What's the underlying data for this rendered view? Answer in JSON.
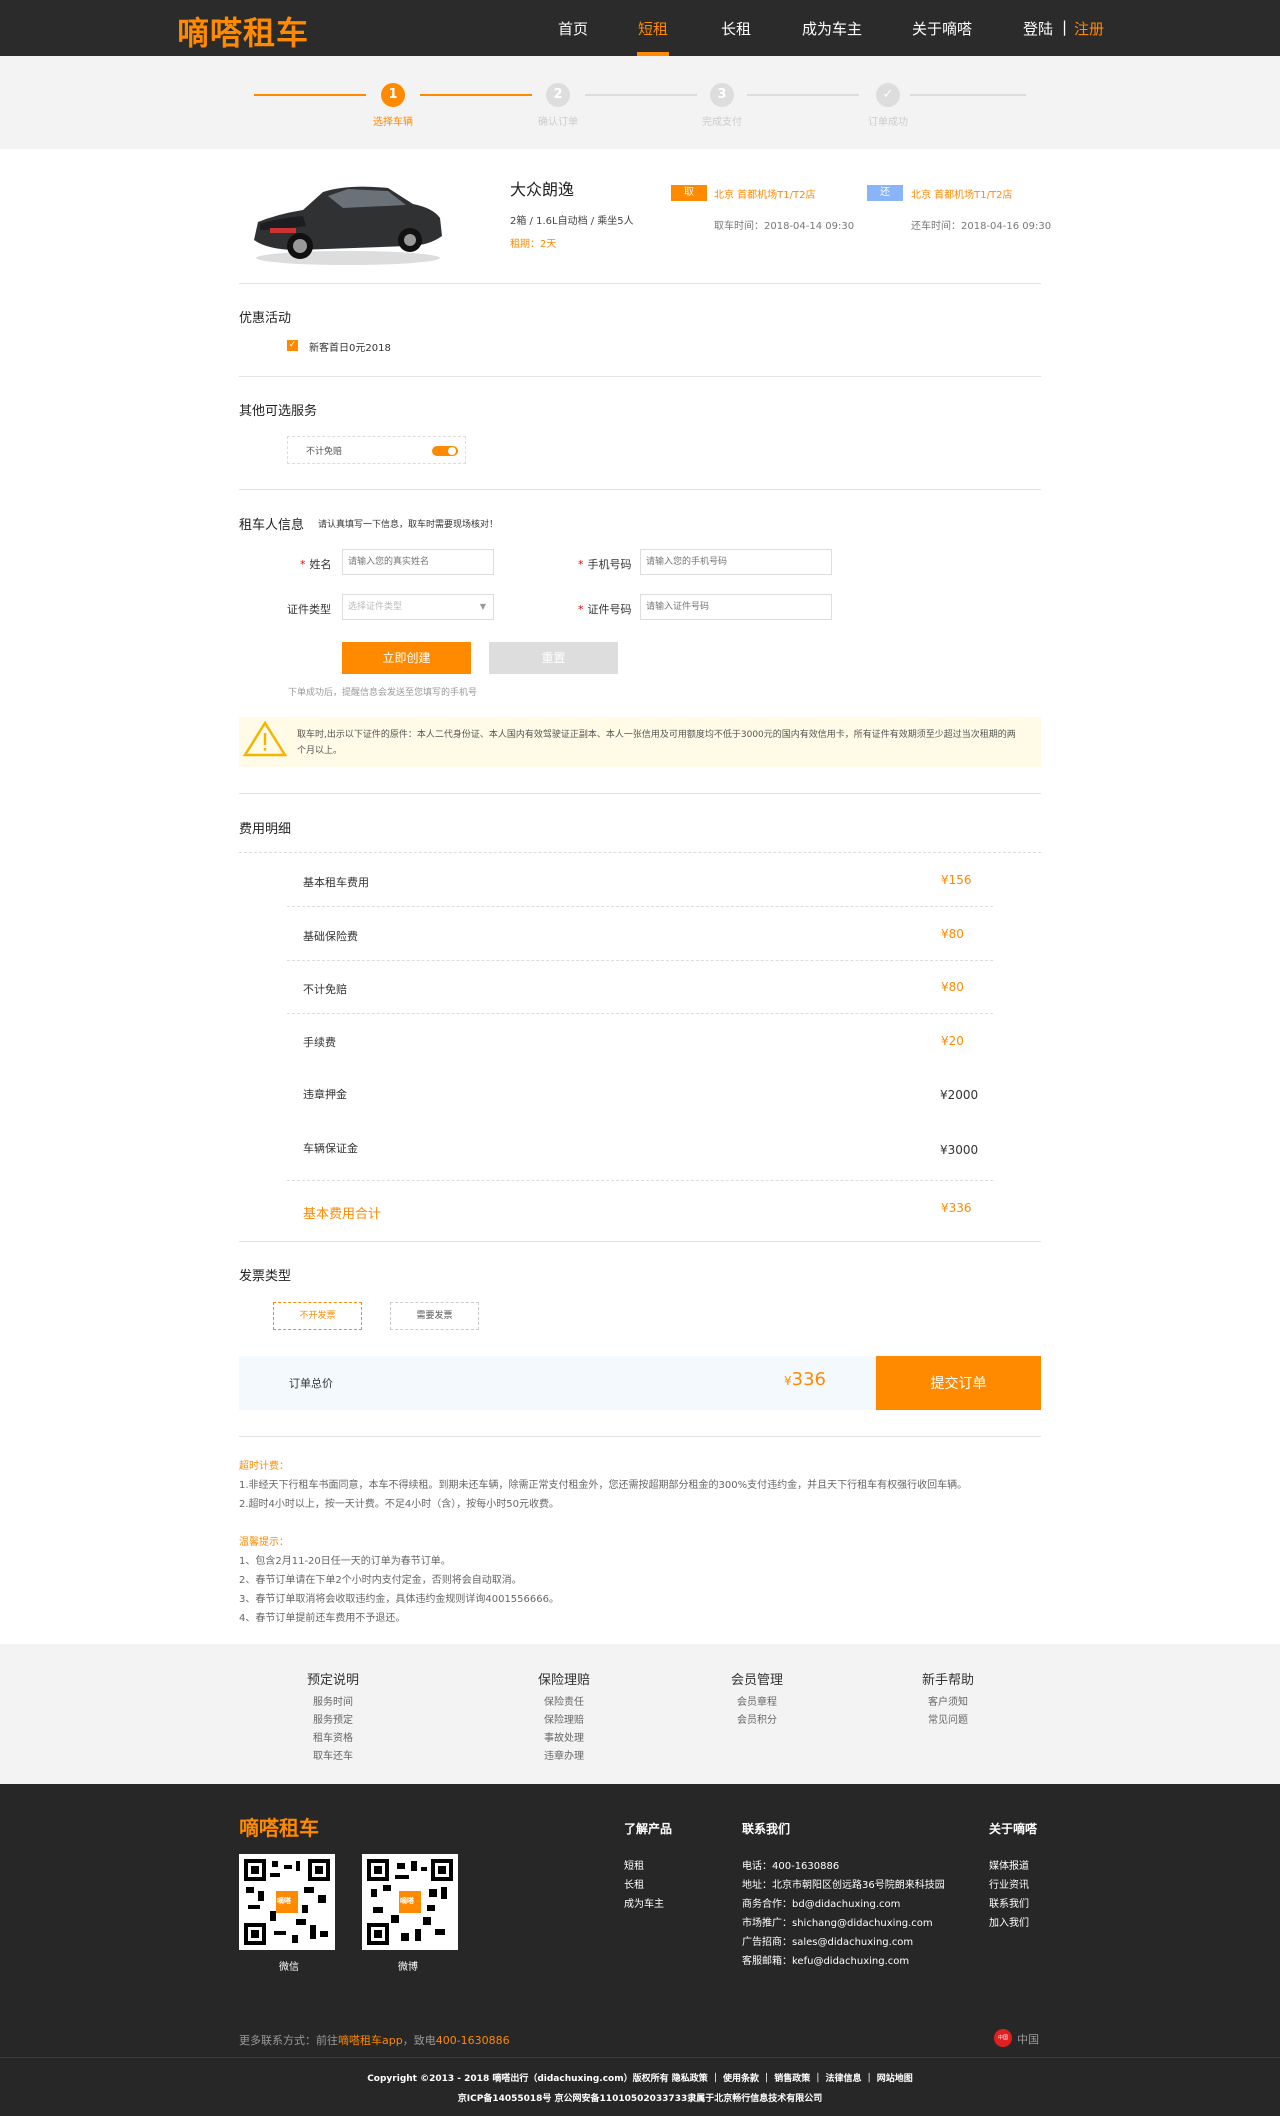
{
  "header": {
    "logo": "嘀嗒租车",
    "nav": [
      "首页",
      "短租",
      "长租",
      "成为车主",
      "关于嘀嗒"
    ],
    "login": "登陆",
    "sep": "|",
    "register": "注册"
  },
  "steps": [
    {
      "num": "1",
      "label": "选择车辆"
    },
    {
      "num": "2",
      "label": "确认订单"
    },
    {
      "num": "3",
      "label": "完成支付"
    },
    {
      "num": "✓",
      "label": "订单成功"
    }
  ],
  "car": {
    "name": "大众朗逸",
    "spec": "2箱 / 1.6L自动档 / 乘坐5人",
    "days": "租期：2天",
    "pickup_badge": "取",
    "return_badge": "还",
    "pickup_loc": "北京 首都机场T1/T2店",
    "return_loc": "北京 首都机场T1/T2店",
    "pickup_time": "取车时间：2018-04-14 09:30",
    "return_time": "还车时间：2018-04-16 09:30"
  },
  "promo": {
    "title": "优惠活动",
    "item": "新客首日0元2018"
  },
  "services": {
    "title": "其他可选服务",
    "item": "不计免赔"
  },
  "renter": {
    "title": "租车人信息",
    "hint": "请认真填写一下信息，取车时需要现场核对！",
    "name_label": "姓名",
    "name_ph": "请输入您的真实姓名",
    "phone_label": "手机号码",
    "phone_ph": "请输入您的手机号码",
    "idtype_label": "证件类型",
    "idtype_ph": "选择证件类型",
    "idnum_label": "证件号码",
    "idnum_ph": "请输入证件号码",
    "req": "*",
    "create_btn": "立即创建",
    "reset_btn": "重置",
    "submit_hint": "下单成功后，提醒信息会发送至您填写的手机号",
    "warning": "取车时,出示以下证件的原件：本人二代身份证、本人国内有效驾驶证正副本、本人一张信用及可用额度均不低于3000元的国内有效信用卡，所有证件有效期须至少超过当次租期的两个月以上。"
  },
  "fees": {
    "title": "费用明细",
    "items": [
      {
        "name": "基本租车费用",
        "value": "¥156"
      },
      {
        "name": "基础保险费",
        "value": "¥80"
      },
      {
        "name": "不计免赔",
        "value": "¥80"
      },
      {
        "name": "手续费",
        "value": "¥20"
      },
      {
        "name": "违章押金",
        "value": "¥2000"
      },
      {
        "name": "车辆保证金",
        "value": "¥3000"
      }
    ],
    "total_label": "基本费用合计",
    "total_value": "¥336"
  },
  "invoice": {
    "title": "发票类型",
    "opt1": "不开发票",
    "opt2": "需要发票"
  },
  "order": {
    "label": "订单总价",
    "currency": "¥",
    "amount": "336",
    "submit": "提交订单"
  },
  "notes": {
    "overtime_title": "超时计费：",
    "overtime": [
      "1.非经天下行租车书面同意，本车不得续租。到期未还车辆，除需正常支付租金外，您还需按超期部分租金的300%支付违约金，并且天下行租车有权强行收回车辆。",
      "2.超时4小时以上，按一天计费。不足4小时（含），按每小时50元收费。"
    ],
    "tips_title": "温馨提示：",
    "tips": [
      "1、包含2月11-20日任一天的订单为春节订单。",
      "2、春节订单请在下单2个小时内支付定金，否则将会自动取消。",
      "3、春节订单取消将会收取违约金，具体违约金规则详询4001556666。",
      "4、春节订单提前还车费用不予退还。"
    ]
  },
  "footer_links": [
    {
      "title": "预定说明",
      "items": [
        "服务时间",
        "服务预定",
        "租车资格",
        "取车还车"
      ]
    },
    {
      "title": "保险理赔",
      "items": [
        "保险责任",
        "保险理赔",
        "事故处理",
        "违章办理"
      ]
    },
    {
      "title": "会员管理",
      "items": [
        "会员章程",
        "会员积分"
      ]
    },
    {
      "title": "新手帮助",
      "items": [
        "客户须知",
        "常见问题"
      ]
    }
  ],
  "footer": {
    "logo": "嘀嗒租车",
    "qr1": "微信",
    "qr2": "微博",
    "qr_center": "嘀嗒",
    "products_title": "了解产品",
    "products": [
      "短租",
      "长租",
      "成为车主"
    ],
    "contact_title": "联系我们",
    "contact": [
      "电话：400-1630886",
      "地址：北京市朝阳区创远路36号院朗来科技园",
      "商务合作：bd@didachuxing.com",
      "市场推广：shichang@didachuxing.com",
      "广告招商：sales@didachuxing.com",
      "客服邮箱：kefu@didachuxing.com"
    ],
    "about_title": "关于嘀嗒",
    "about": [
      "媒体报道",
      "行业资讯",
      "联系我们",
      "加入我们"
    ],
    "more_prefix": "更多联系方式：前往",
    "more_app": "嘀嗒租车app",
    "more_mid": "，致电",
    "more_phone": "400-1630886",
    "lang_badge": "中国",
    "lang": "中国",
    "copyright": "Copyright ©2013 - 2018 嘀嗒出行（didachuxing.com）版权所有 隐私政策 ｜ 使用条款 ｜ 销售政策 ｜ 法律信息 ｜ 网站地图",
    "icp": "京ICP备14055018号 京公网安备11010502033733隶属于北京畅行信息技术有限公司"
  }
}
